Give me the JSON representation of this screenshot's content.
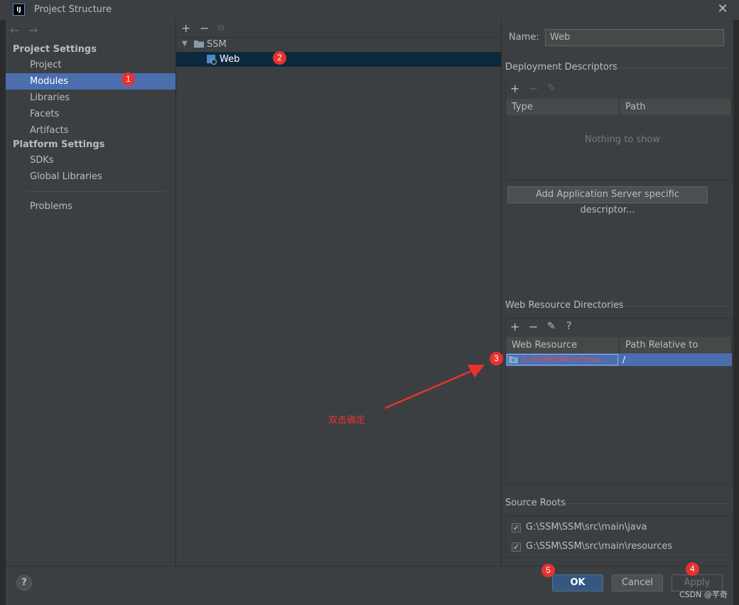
{
  "window": {
    "title": "Project Structure",
    "app_icon_text": "IJ",
    "close_glyph": "✕"
  },
  "sidebar": {
    "back_glyph": "←",
    "forward_glyph": "→",
    "sections": [
      {
        "header": "Project Settings",
        "items": [
          "Project",
          "Modules",
          "Libraries",
          "Facets",
          "Artifacts"
        ]
      },
      {
        "header": "Platform Settings",
        "items": [
          "SDKs",
          "Global Libraries"
        ]
      }
    ],
    "problems": "Problems",
    "selected": "Modules"
  },
  "tree": {
    "toolbar": [
      "+",
      "−",
      "⧉"
    ],
    "root": "SSM",
    "child": "Web"
  },
  "module": {
    "name_label": "Name:",
    "name_value": "Web"
  },
  "deployment": {
    "title": "Deployment Descriptors",
    "toolbar": [
      "+",
      "−",
      "✎"
    ],
    "columns": [
      "Type",
      "Path"
    ],
    "empty_text": "Nothing to show",
    "add_button": "Add Application Server specific descriptor..."
  },
  "web_resources": {
    "title": "Web Resource Directories",
    "toolbar": [
      "+",
      "−",
      "✎",
      "?"
    ],
    "columns": [
      "Web Resource Directory",
      "Path Relative to Deplo..."
    ],
    "rows": [
      {
        "directory": "G:\\SSM\\SSM\\src\\mai...",
        "path": "/"
      }
    ]
  },
  "source_roots": {
    "title": "Source Roots",
    "items": [
      {
        "path": "G:\\SSM\\SSM\\src\\main\\java",
        "checked": true
      },
      {
        "path": "G:\\SSM\\SSM\\src\\main\\resources",
        "checked": true
      }
    ]
  },
  "footer": {
    "help": "?",
    "ok": "OK",
    "cancel": "Cancel",
    "apply": "Apply"
  },
  "annotations": {
    "badges": [
      "1",
      "2",
      "3",
      "4",
      "5"
    ],
    "note": "双击确定",
    "color": "#e8322e"
  },
  "watermark": "CSDN @芊奇",
  "colors": {
    "selection": "#4b6eaf",
    "panel": "#3c3f41",
    "ok_button": "#365880",
    "error_text": "#e05555"
  }
}
